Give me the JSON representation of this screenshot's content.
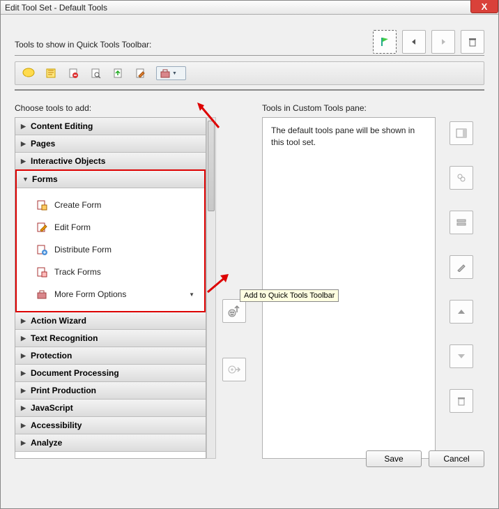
{
  "window": {
    "title": "Edit Tool Set - Default Tools"
  },
  "labels": {
    "quick_tools": "Tools to show in Quick Tools Toolbar:",
    "choose": "Choose tools to add:",
    "custom": "Tools in Custom Tools pane:"
  },
  "top_buttons": [
    "flag-icon",
    "prev-icon",
    "next-icon",
    "trash-icon"
  ],
  "quick_toolbar_icons": [
    "comment",
    "highlight",
    "delete-page",
    "find-page",
    "export",
    "edit-pdf",
    "toolbox"
  ],
  "accordion": [
    {
      "label": "Content Editing",
      "expanded": false
    },
    {
      "label": "Pages",
      "expanded": false
    },
    {
      "label": "Interactive Objects",
      "expanded": false
    },
    {
      "label": "Forms",
      "expanded": true,
      "items": [
        {
          "label": "Create Form",
          "icon": "create-form"
        },
        {
          "label": "Edit Form",
          "icon": "edit-form"
        },
        {
          "label": "Distribute Form",
          "icon": "distribute-form"
        },
        {
          "label": "Track Forms",
          "icon": "track-forms"
        },
        {
          "label": "More Form Options",
          "icon": "toolbox",
          "dropdown": true
        }
      ]
    },
    {
      "label": "Action Wizard",
      "expanded": false
    },
    {
      "label": "Text Recognition",
      "expanded": false
    },
    {
      "label": "Protection",
      "expanded": false
    },
    {
      "label": "Document Processing",
      "expanded": false
    },
    {
      "label": "Print Production",
      "expanded": false
    },
    {
      "label": "JavaScript",
      "expanded": false
    },
    {
      "label": "Accessibility",
      "expanded": false
    },
    {
      "label": "Analyze",
      "expanded": false
    }
  ],
  "custom_pane_text": "The default tools pane will be shown in this tool set.",
  "tooltip": "Add to Quick Tools Toolbar",
  "footer": {
    "save": "Save",
    "cancel": "Cancel"
  }
}
